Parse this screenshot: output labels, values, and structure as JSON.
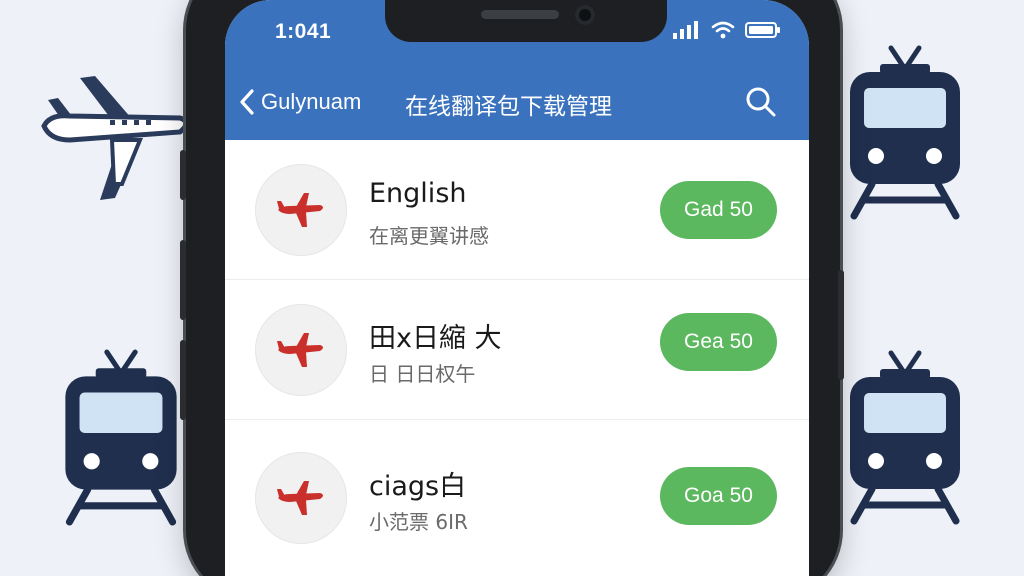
{
  "status_bar": {
    "time": "1:041"
  },
  "header": {
    "back_label": "Gulynuam",
    "title": "在线翻译包下载管理"
  },
  "languages": [
    {
      "name": "English",
      "subtitle": "在离更翼讲感",
      "button": "Gad 50"
    },
    {
      "name": "田x日縮 大",
      "subtitle": "日 日日权午",
      "button": "Gea 50"
    },
    {
      "name": "ciags白",
      "subtitle": "小范票 6IR",
      "button": "Goa 50"
    }
  ],
  "colors": {
    "header_blue": "#3a72be",
    "button_green": "#5cb85f",
    "plane_red": "#c9302c",
    "icon_navy": "#1f2f4d"
  },
  "icons": {
    "back": "chevron-left-icon",
    "search": "search-icon",
    "row_avatar": "airplane-icon",
    "signal": "signal-icon",
    "wifi": "wifi-icon",
    "battery": "battery-icon"
  }
}
